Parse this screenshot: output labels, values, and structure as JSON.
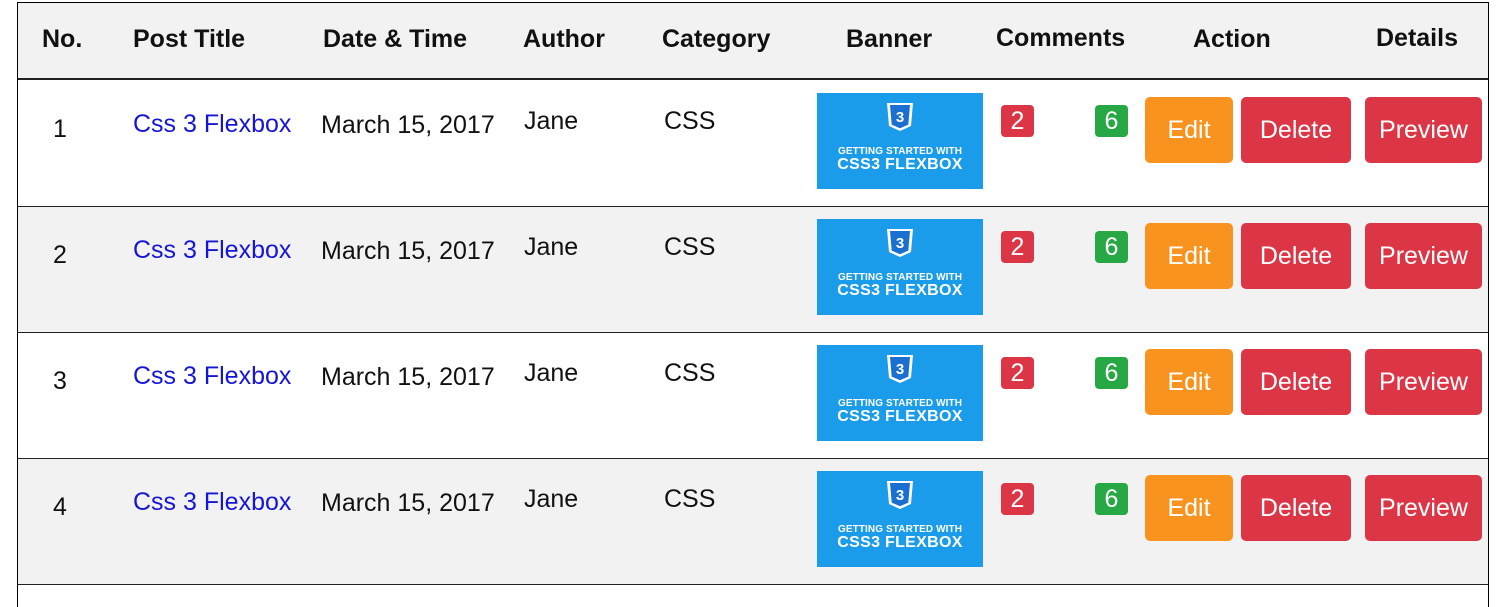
{
  "headers": {
    "no": "No.",
    "post_title": "Post Title",
    "date_time": "Date & Time",
    "author": "Author",
    "category": "Category",
    "banner": "Banner",
    "comments": "Comments",
    "action": "Action",
    "details": "Details"
  },
  "banner_text": {
    "line1": "GETTING STARTED WITH",
    "line2": "CSS3 FLEXBOX",
    "icon": "css3-logo-icon"
  },
  "rows": [
    {
      "no": "1",
      "title": "Css 3 Flexbox",
      "date": "March 15, 2017",
      "author": "Jane",
      "category": "CSS",
      "comments_red": "2",
      "comments_green": "6",
      "edit": "Edit",
      "delete": "Delete",
      "preview": "Preview"
    },
    {
      "no": "2",
      "title": "Css 3 Flexbox",
      "date": "March 15, 2017",
      "author": "Jane",
      "category": "CSS",
      "comments_red": "2",
      "comments_green": "6",
      "edit": "Edit",
      "delete": "Delete",
      "preview": "Preview"
    },
    {
      "no": "3",
      "title": "Css 3 Flexbox",
      "date": "March 15, 2017",
      "author": "Jane",
      "category": "CSS",
      "comments_red": "2",
      "comments_green": "6",
      "edit": "Edit",
      "delete": "Delete",
      "preview": "Preview"
    },
    {
      "no": "4",
      "title": "Css 3 Flexbox",
      "date": "March 15, 2017",
      "author": "Jane",
      "category": "CSS",
      "comments_red": "2",
      "comments_green": "6",
      "edit": "Edit",
      "delete": "Delete",
      "preview": "Preview"
    }
  ],
  "colors": {
    "link": "#1515d6",
    "banner_bg": "#1a9ceb",
    "badge_red": "#dc3545",
    "badge_green": "#28a745",
    "edit_button": "#f7931e",
    "delete_button": "#dc3545",
    "preview_button": "#dc3545",
    "header_bg": "#f2f2f2",
    "stripe_bg": "#f2f2f2"
  }
}
